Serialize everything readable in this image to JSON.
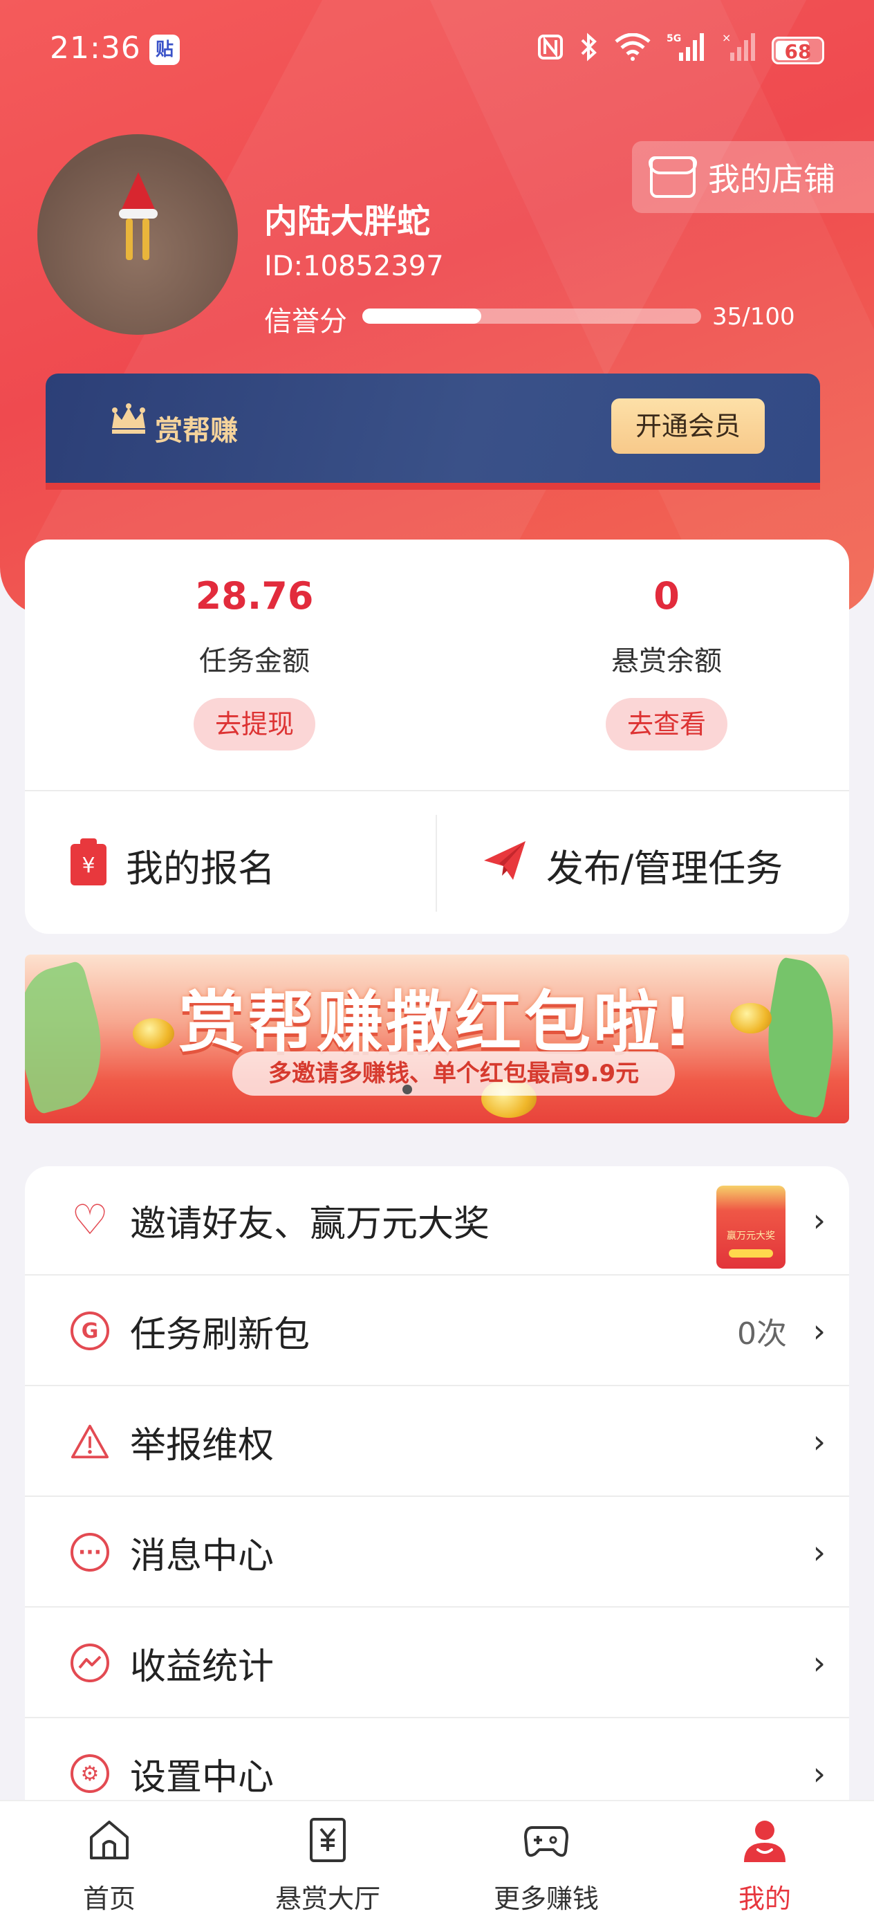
{
  "status_bar": {
    "time": "21:36",
    "app_badge": "贴",
    "battery": "68",
    "icons": [
      "nfc-icon",
      "bluetooth-icon",
      "wifi-icon",
      "5g-signal-icon",
      "signal-icon",
      "battery-icon"
    ]
  },
  "profile": {
    "name": "内陆大胖蛇",
    "id": "ID:10852397",
    "credit_label": "信誉分",
    "credit_score": "35/100",
    "credit_fraction": 0.35,
    "shop_label": "我的店铺"
  },
  "vip": {
    "title": "赏帮赚",
    "button": "开通会员"
  },
  "balance": {
    "task_amount": "28.76",
    "task_amount_label": "任务金额",
    "task_amount_button": "去提现",
    "reward_balance": "0",
    "reward_balance_label": "悬赏余额",
    "reward_balance_button": "去查看"
  },
  "actions": {
    "my_signup": "我的报名",
    "publish_manage": "发布/管理任务"
  },
  "banner": {
    "title": "赏帮赚撒红包啦!",
    "subtitle": "多邀请多赚钱、单个红包最高9.9元"
  },
  "menu": {
    "items": [
      {
        "label": "邀请好友、赢万元大奖",
        "value": ""
      },
      {
        "label": "任务刷新包",
        "value": "0次"
      },
      {
        "label": "举报维权",
        "value": ""
      },
      {
        "label": "消息中心",
        "value": ""
      },
      {
        "label": "收益统计",
        "value": ""
      },
      {
        "label": "设置中心",
        "value": ""
      }
    ],
    "gift_text": "赢万元大奖"
  },
  "nav": {
    "items": [
      {
        "label": "首页",
        "icon": "home-icon"
      },
      {
        "label": "悬赏大厅",
        "icon": "reward-hall-icon"
      },
      {
        "label": "更多赚钱",
        "icon": "gamepad-icon"
      },
      {
        "label": "我的",
        "icon": "profile-icon"
      }
    ],
    "active_index": 3,
    "active_color": "#e7363e"
  },
  "colors": {
    "header_red": "#ef4a4f",
    "accent_red": "#e22b3c",
    "vip_navy": "#2c3f77",
    "vip_gold": "#f5d39b"
  }
}
